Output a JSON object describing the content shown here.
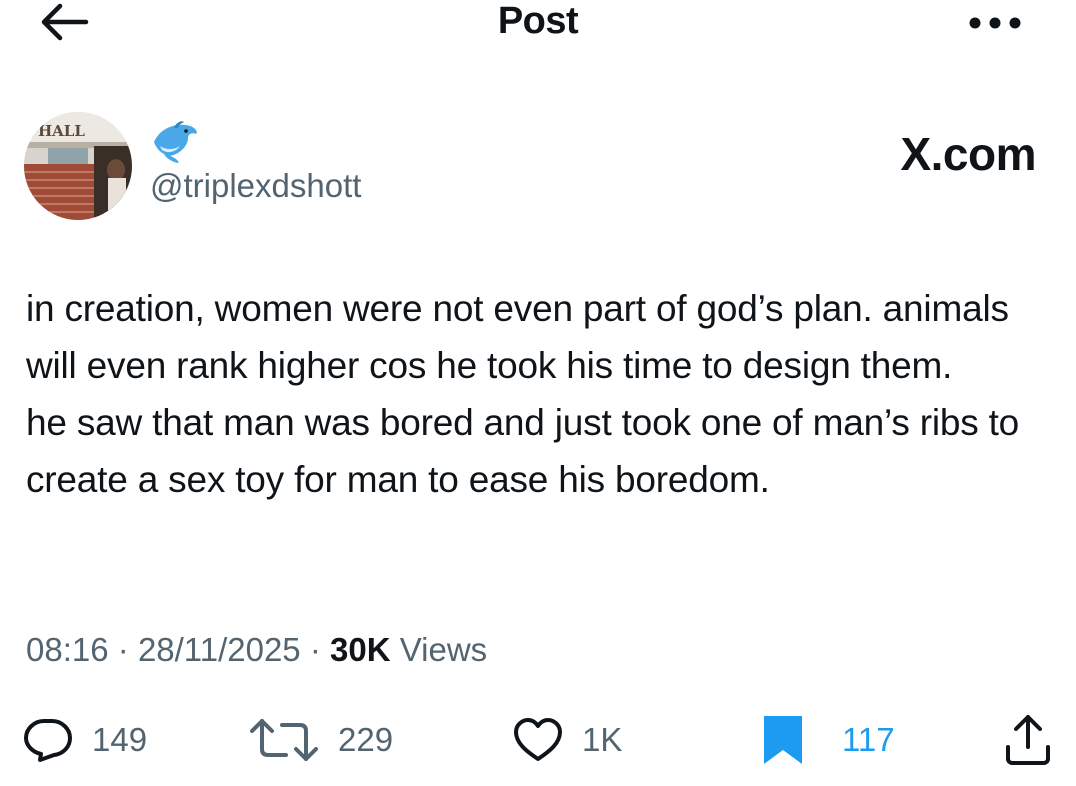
{
  "header": {
    "title": "Post"
  },
  "author": {
    "handle": "@triplexdshott",
    "badge_icon": "dolphin-emoji"
  },
  "watermark": {
    "text": "X.com"
  },
  "post": {
    "paragraphs": [
      "in creation, women were not even part of god’s plan. animals will even rank higher cos he took his time to design them.",
      "he saw that man was bored and just took one of man’s ribs to create a sex toy for man to ease his boredom."
    ]
  },
  "meta": {
    "time": "08:16",
    "date": "28/11/2025",
    "views_count": "30K",
    "views_label": "Views",
    "separator": "·"
  },
  "actions": {
    "replies": "149",
    "reposts": "229",
    "likes": "1K",
    "bookmarks": "117"
  },
  "colors": {
    "accent": "#1d9bf0",
    "secondary_text": "#536471",
    "primary_text": "#0f1419"
  },
  "icons": {
    "back": "arrow-left-icon",
    "more": "more-dots-icon",
    "reply": "reply-icon",
    "repost": "repost-icon",
    "like": "heart-icon",
    "bookmark": "bookmark-icon",
    "share": "share-icon"
  }
}
